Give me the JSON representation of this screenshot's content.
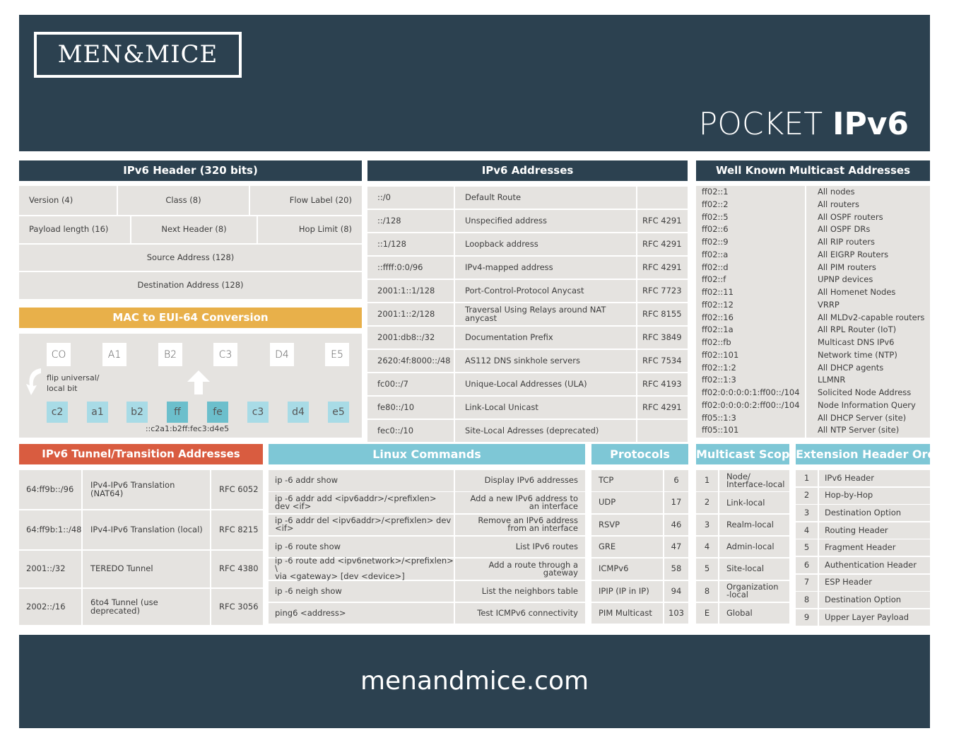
{
  "brand": {
    "logo": "MEN&MICE",
    "title_light": "POCKET ",
    "title_bold": "IPv6",
    "footer_url": "menandmice.com"
  },
  "colors": {
    "navy": "#2c4150",
    "cell": "#e5e3e0",
    "orange": "#e8b04a",
    "red": "#d95c40",
    "teal": "#7ec7d6",
    "eui_light": "#a8dbe6",
    "eui_dark": "#6cbfcc"
  },
  "ipv6_header": {
    "title": "IPv6 Header (320 bits)",
    "row1": [
      "Version (4)",
      "Class (8)",
      "Flow Label (20)"
    ],
    "row2": [
      "Payload length (16)",
      "Next Header (8)",
      "Hop Limit (8)"
    ],
    "row3": "Source Address (128)",
    "row4": "Destination Address (128)"
  },
  "mac_eui": {
    "title": "MAC to EUI-64 Conversion",
    "mac_octets": [
      "CO",
      "A1",
      "B2",
      "C3",
      "D4",
      "E5"
    ],
    "eui_octets": [
      "c2",
      "a1",
      "b2",
      "ff",
      "fe",
      "c3",
      "d4",
      "e5"
    ],
    "flip_label_1": "flip universal/",
    "flip_label_2": "local bit",
    "result": "::c2a1:b2ff:fec3:d4e5"
  },
  "ipv6_addresses": {
    "title": "IPv6  Addresses",
    "rows": [
      {
        "prefix": "::/0",
        "desc": "Default Route",
        "rfc": ""
      },
      {
        "prefix": "::/128",
        "desc": "Unspecified address",
        "rfc": "RFC 4291"
      },
      {
        "prefix": "::1/128",
        "desc": "Loopback address",
        "rfc": "RFC 4291"
      },
      {
        "prefix": "::ffff:0:0/96",
        "desc": "IPv4-mapped address",
        "rfc": "RFC 4291"
      },
      {
        "prefix": "2001:1::1/128",
        "desc": "Port-Control-Protocol Anycast",
        "rfc": "RFC 7723"
      },
      {
        "prefix": "2001:1::2/128",
        "desc": "Traversal Using Relays around NAT anycast",
        "rfc": "RFC 8155"
      },
      {
        "prefix": "2001:db8::/32",
        "desc": "Documentation Prefix",
        "rfc": "RFC 3849"
      },
      {
        "prefix": "2620:4f:8000::/48",
        "desc": "AS112 DNS sinkhole servers",
        "rfc": "RFC 7534"
      },
      {
        "prefix": "fc00::/7",
        "desc": "Unique-Local Addresses (ULA)",
        "rfc": "RFC 4193"
      },
      {
        "prefix": "fe80::/10",
        "desc": "Link-Local Unicast",
        "rfc": "RFC 4291"
      },
      {
        "prefix": "fec0::/10",
        "desc": "Site-Local Adresses (deprecated)",
        "rfc": ""
      }
    ]
  },
  "multicast": {
    "title": "Well Known Multicast Addresses",
    "rows": [
      {
        "addr": "ff02::1",
        "desc": "All nodes"
      },
      {
        "addr": "ff02::2",
        "desc": "All routers"
      },
      {
        "addr": "ff02::5",
        "desc": "All OSPF routers"
      },
      {
        "addr": "ff02::6",
        "desc": "All OSPF DRs"
      },
      {
        "addr": "ff02::9",
        "desc": "All RIP routers"
      },
      {
        "addr": "ff02::a",
        "desc": "All EIGRP Routers"
      },
      {
        "addr": "ff02::d",
        "desc": "All PIM routers"
      },
      {
        "addr": "ff02::f",
        "desc": "UPNP devices"
      },
      {
        "addr": "ff02::11",
        "desc": "All Homenet Nodes"
      },
      {
        "addr": "ff02::12",
        "desc": "VRRP"
      },
      {
        "addr": "ff02::16",
        "desc": "All MLDv2-capable routers"
      },
      {
        "addr": "ff02::1a",
        "desc": "All RPL Router (IoT)"
      },
      {
        "addr": "ff02::fb",
        "desc": "Multicast DNS IPv6"
      },
      {
        "addr": "ff02::101",
        "desc": "Network time (NTP)"
      },
      {
        "addr": "ff02::1:2",
        "desc": "All DHCP agents"
      },
      {
        "addr": "ff02::1:3",
        "desc": "LLMNR"
      },
      {
        "addr": "ff02:0:0:0:0:1:ff00::/104",
        "desc": "Solicited Node Address"
      },
      {
        "addr": "ff02:0:0:0:0:2:ff00::/104",
        "desc": "Node Information Query"
      },
      {
        "addr": "ff05::1:3",
        "desc": "All DHCP Server (site)"
      },
      {
        "addr": "ff05::101",
        "desc": "All NTP Server (site)"
      }
    ]
  },
  "tunnel": {
    "title": "IPv6 Tunnel/Transition Addresses",
    "rows": [
      {
        "prefix": "64:ff9b::/96",
        "desc": "IPv4-IPv6 Translation (NAT64)",
        "rfc": "RFC 6052"
      },
      {
        "prefix": "64:ff9b:1::/48",
        "desc": "IPv4-IPv6 Translation (local)",
        "rfc": "RFC 8215"
      },
      {
        "prefix": "2001::/32",
        "desc": "TEREDO Tunnel",
        "rfc": "RFC 4380"
      },
      {
        "prefix": "2002::/16",
        "desc": "6to4 Tunnel (use deprecated)",
        "rfc": "RFC 3056"
      }
    ]
  },
  "linux": {
    "title": "Linux Commands",
    "rows": [
      {
        "cmd": [
          "ip -6 addr show"
        ],
        "desc": [
          "Display IPv6 addresses"
        ]
      },
      {
        "cmd": [
          "ip -6 addr add <ipv6addr>/<prefixlen> dev <if>"
        ],
        "desc": [
          "Add a new IPv6 address to",
          "an interface"
        ]
      },
      {
        "cmd": [
          "ip -6 addr del <ipv6addr>/<prefixlen> dev <if>"
        ],
        "desc": [
          "Remove an IPv6 address",
          "from an interface"
        ]
      },
      {
        "cmd": [
          "ip -6 route show"
        ],
        "desc": [
          "List IPv6 routes"
        ]
      },
      {
        "cmd": [
          "ip -6 route add <ipv6network>/<prefixlen> \\",
          "via <gateway> [dev <device>]"
        ],
        "desc": [
          "Add a route through a gateway"
        ]
      },
      {
        "cmd": [
          "ip -6 neigh show"
        ],
        "desc": [
          "List the neighbors table"
        ]
      },
      {
        "cmd": [
          "ping6 <address>"
        ],
        "desc": [
          "Test ICMPv6 connectivity"
        ]
      }
    ]
  },
  "protocols": {
    "title": "Protocols",
    "rows": [
      {
        "name": "TCP",
        "num": "6"
      },
      {
        "name": "UDP",
        "num": "17"
      },
      {
        "name": "RSVP",
        "num": "46"
      },
      {
        "name": "GRE",
        "num": "47"
      },
      {
        "name": "ICMPv6",
        "num": "58"
      },
      {
        "name": "IPIP (IP in IP)",
        "num": "94"
      },
      {
        "name": "PIM Multicast",
        "num": "103"
      }
    ]
  },
  "scopes": {
    "title": "Multicast Scopes",
    "rows": [
      {
        "id": "1",
        "name": [
          "Node/",
          "Interface-local"
        ]
      },
      {
        "id": "2",
        "name": [
          "Link-local"
        ]
      },
      {
        "id": "3",
        "name": [
          "Realm-local"
        ]
      },
      {
        "id": "4",
        "name": [
          "Admin-local"
        ]
      },
      {
        "id": "5",
        "name": [
          "Site-local"
        ]
      },
      {
        "id": "8",
        "name": [
          "Organization",
          "-local"
        ]
      },
      {
        "id": "E",
        "name": [
          "Global"
        ]
      }
    ]
  },
  "ext_order": {
    "title": "Extension Header Order",
    "rows": [
      {
        "n": "1",
        "name": "IPv6 Header"
      },
      {
        "n": "2",
        "name": "Hop-by-Hop"
      },
      {
        "n": "3",
        "name": "Destination Option"
      },
      {
        "n": "4",
        "name": "Routing Header"
      },
      {
        "n": "5",
        "name": "Fragment Header"
      },
      {
        "n": "6",
        "name": "Authentication Header"
      },
      {
        "n": "7",
        "name": "ESP Header"
      },
      {
        "n": "8",
        "name": "Destination Option"
      },
      {
        "n": "9",
        "name": "Upper Layer Payload"
      }
    ]
  }
}
